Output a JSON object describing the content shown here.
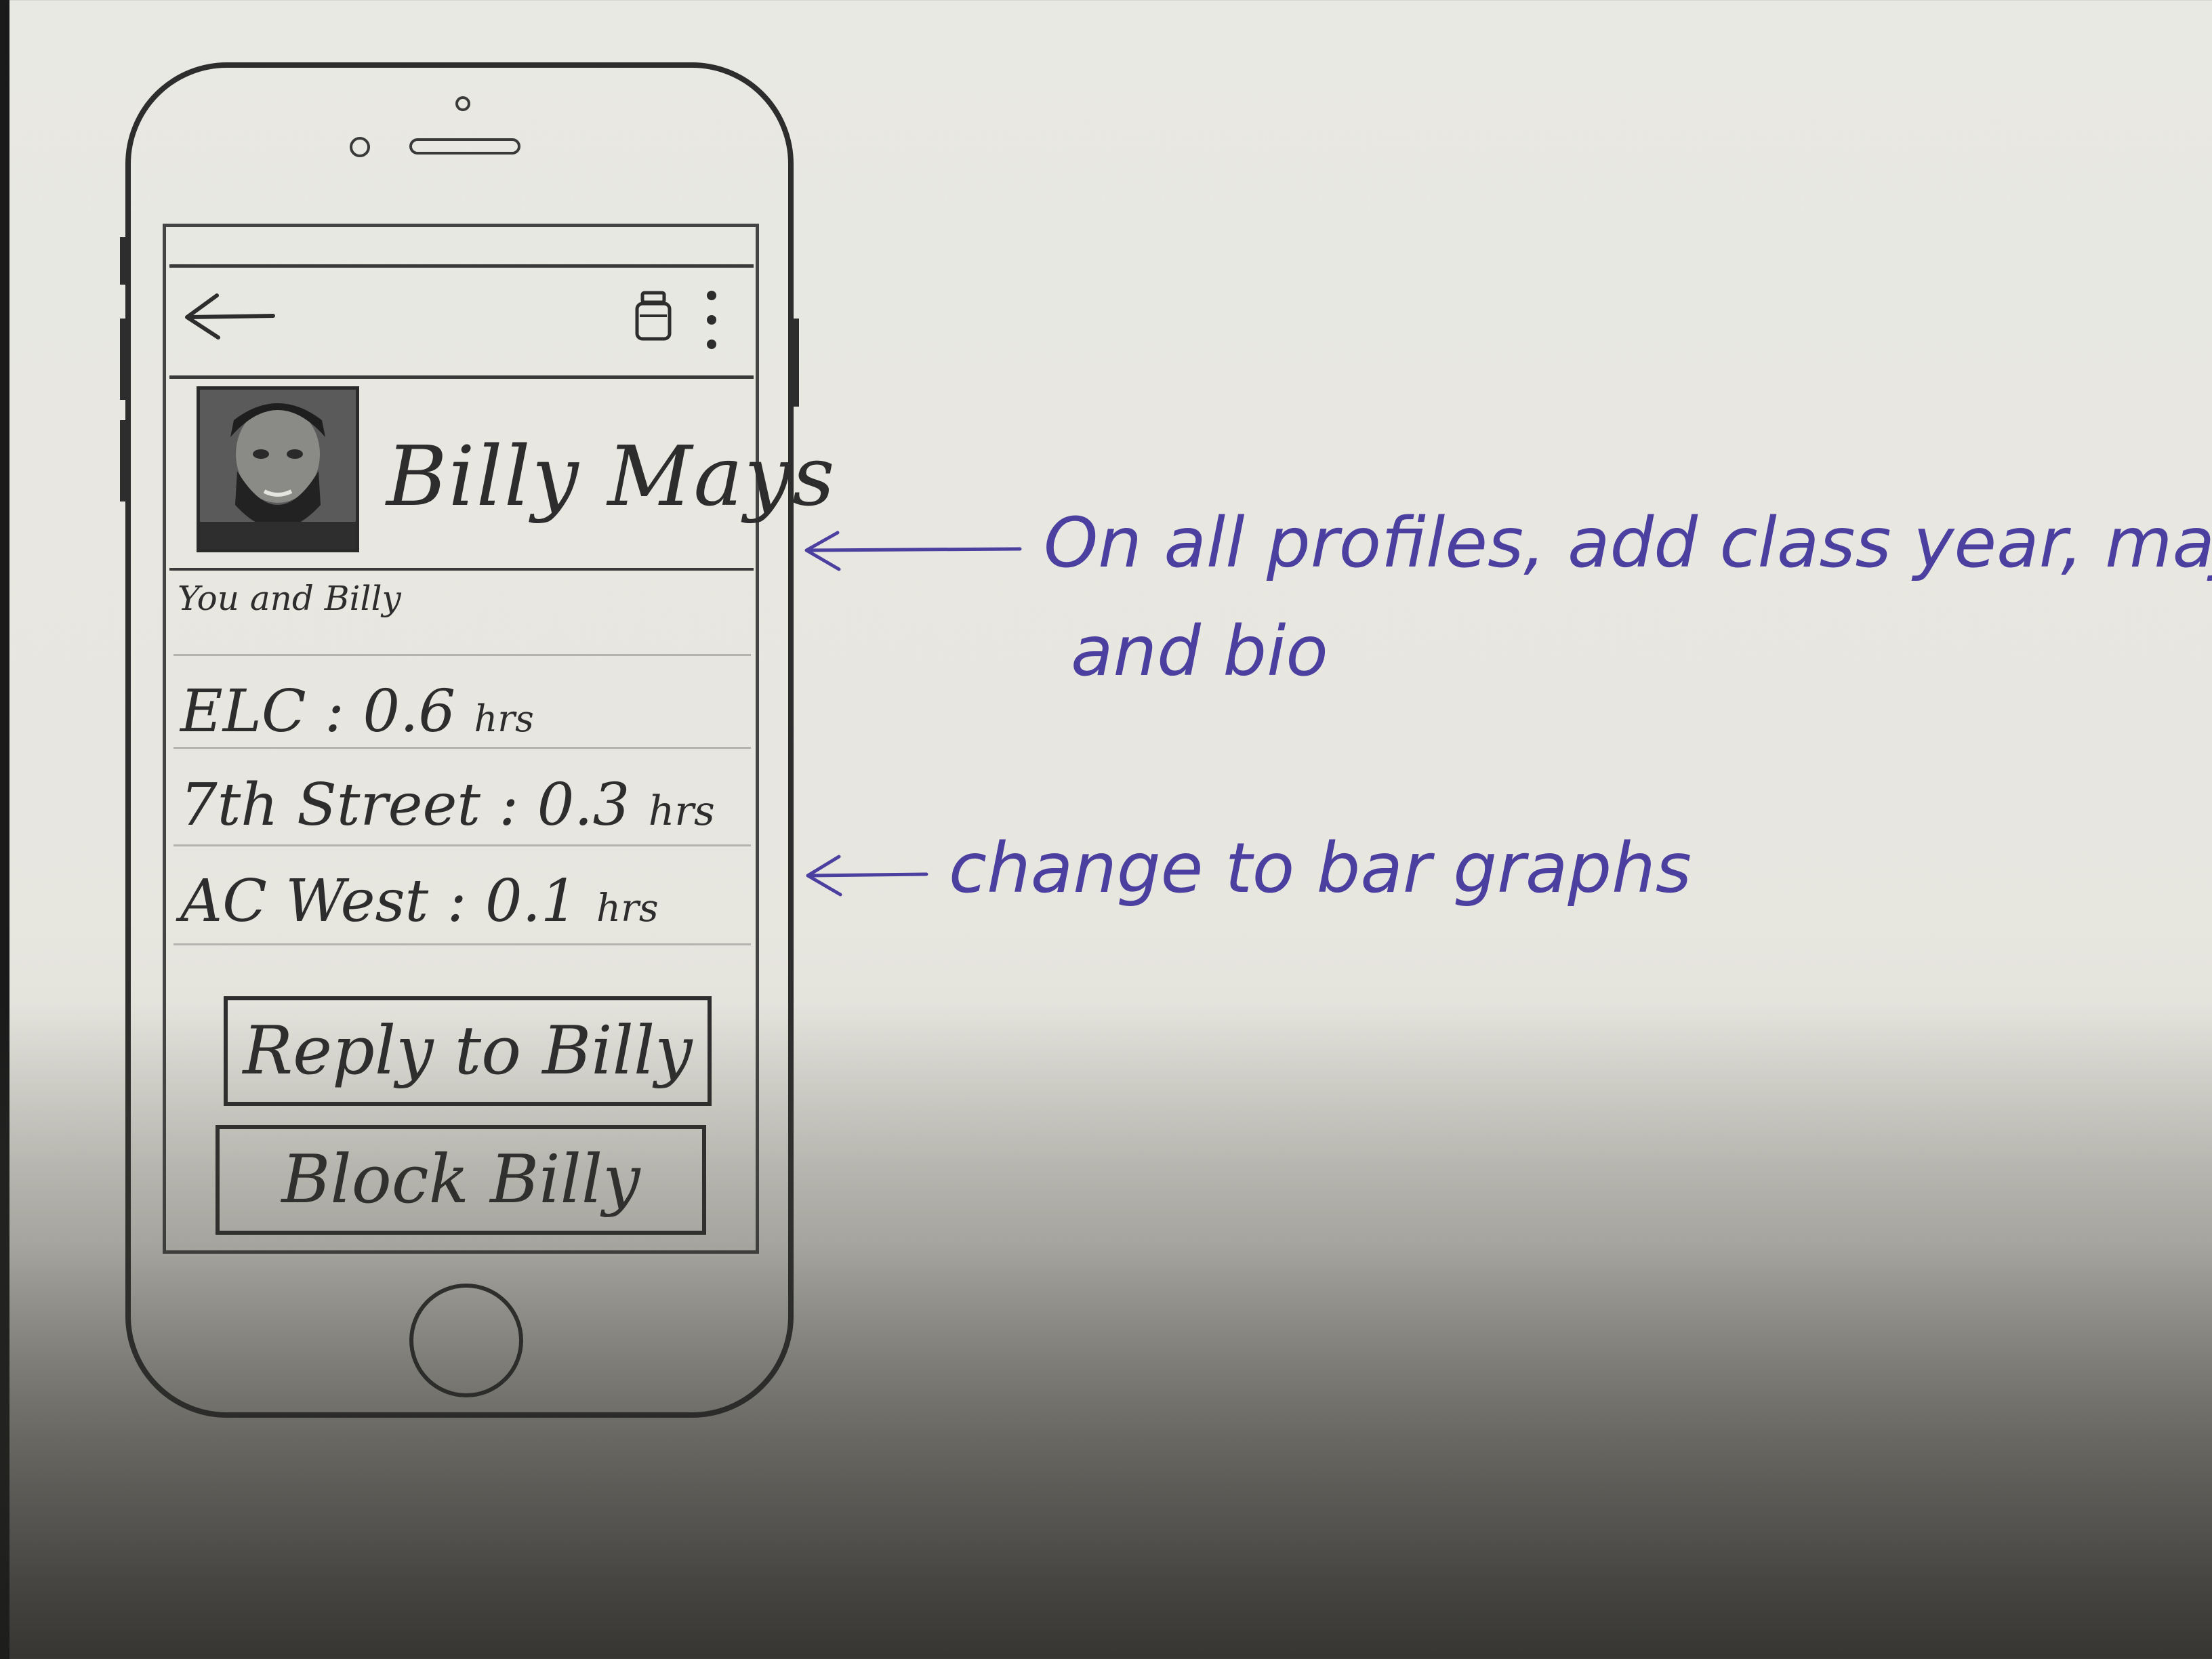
{
  "header": {
    "back_icon": "back-arrow-icon",
    "jar_icon": "jar-icon",
    "menu_icon": "more-vertical-icon"
  },
  "profile": {
    "name": "Billy Mays",
    "avatar": "profile-photo"
  },
  "section_label": "You and Billy",
  "stats": [
    {
      "location": "ELC",
      "value": "0.6",
      "unit": "hrs"
    },
    {
      "location": "7th Street",
      "value": "0.3",
      "unit": "hrs"
    },
    {
      "location": "AC West",
      "value": "0.1",
      "unit": "hrs"
    }
  ],
  "buttons": {
    "reply": "Reply to Billy",
    "block": "Block Billy"
  },
  "annotations": {
    "note1_line1": "On all profiles, add class year, major,",
    "note1_line2": "and bio",
    "note2": "change to bar graphs",
    "ink_color": "#4b3fa0"
  }
}
